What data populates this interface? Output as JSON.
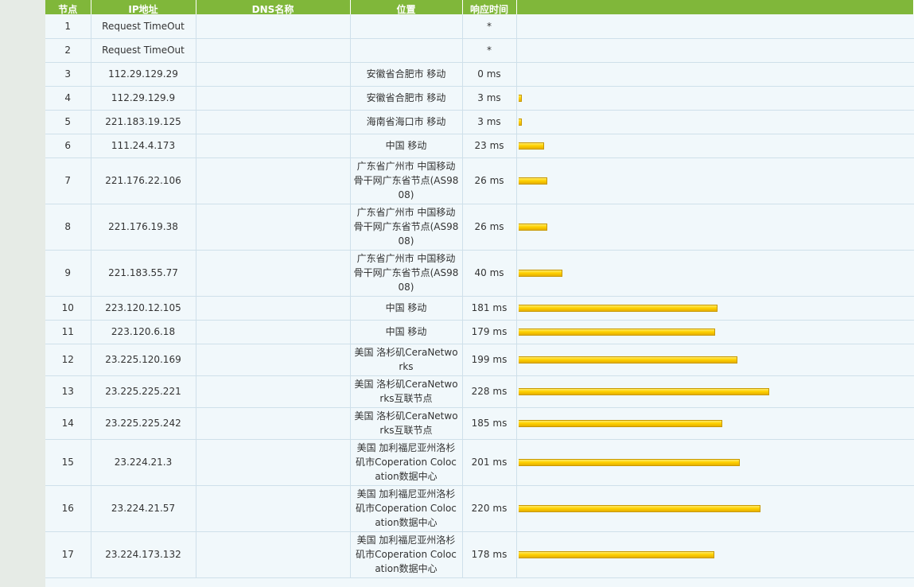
{
  "headers": [
    "节点",
    "IP地址",
    "DNS名称",
    "位置",
    "响应时间",
    ""
  ],
  "rows": [
    {
      "node": "1",
      "ip": "Request TimeOut",
      "dns": "",
      "location": "",
      "time": "*",
      "ms": null
    },
    {
      "node": "2",
      "ip": "Request TimeOut",
      "dns": "",
      "location": "",
      "time": "*",
      "ms": null
    },
    {
      "node": "3",
      "ip": "112.29.129.29",
      "dns": "",
      "location": "安徽省合肥市 移动",
      "time": "0 ms",
      "ms": 0
    },
    {
      "node": "4",
      "ip": "112.29.129.9",
      "dns": "",
      "location": "安徽省合肥市 移动",
      "time": "3 ms",
      "ms": 3
    },
    {
      "node": "5",
      "ip": "221.183.19.125",
      "dns": "",
      "location": "海南省海口市 移动",
      "time": "3 ms",
      "ms": 3
    },
    {
      "node": "6",
      "ip": "111.24.4.173",
      "dns": "",
      "location": "中国 移动",
      "time": "23 ms",
      "ms": 23
    },
    {
      "node": "7",
      "ip": "221.176.22.106",
      "dns": "",
      "location": "广东省广州市 中国移动骨干网广东省节点(AS9808)",
      "time": "26 ms",
      "ms": 26
    },
    {
      "node": "8",
      "ip": "221.176.19.38",
      "dns": "",
      "location": "广东省广州市 中国移动骨干网广东省节点(AS9808)",
      "time": "26 ms",
      "ms": 26
    },
    {
      "node": "9",
      "ip": "221.183.55.77",
      "dns": "",
      "location": "广东省广州市 中国移动骨干网广东省节点(AS9808)",
      "time": "40 ms",
      "ms": 40
    },
    {
      "node": "10",
      "ip": "223.120.12.105",
      "dns": "",
      "location": "中国 移动",
      "time": "181 ms",
      "ms": 181
    },
    {
      "node": "11",
      "ip": "223.120.6.18",
      "dns": "",
      "location": "中国 移动",
      "time": "179 ms",
      "ms": 179
    },
    {
      "node": "12",
      "ip": "23.225.120.169",
      "dns": "",
      "location": "美国 洛杉矶CeraNetworks",
      "time": "199 ms",
      "ms": 199
    },
    {
      "node": "13",
      "ip": "23.225.225.221",
      "dns": "",
      "location": "美国 洛杉矶CeraNetworks互联节点",
      "time": "228 ms",
      "ms": 228
    },
    {
      "node": "14",
      "ip": "23.225.225.242",
      "dns": "",
      "location": "美国 洛杉矶CeraNetworks互联节点",
      "time": "185 ms",
      "ms": 185
    },
    {
      "node": "15",
      "ip": "23.224.21.3",
      "dns": "",
      "location": "美国 加利福尼亚州洛杉矶市Coperation Colocation数据中心",
      "time": "201 ms",
      "ms": 201
    },
    {
      "node": "16",
      "ip": "23.224.21.57",
      "dns": "",
      "location": "美国 加利福尼亚州洛杉矶市Coperation Colocation数据中心",
      "time": "220 ms",
      "ms": 220
    },
    {
      "node": "17",
      "ip": "23.224.173.132",
      "dns": "",
      "location": "美国 加利福尼亚州洛杉矶市Coperation Colocation数据中心",
      "time": "178 ms",
      "ms": 178
    }
  ],
  "colors": {
    "header_bg": "#80b73a",
    "bar": "#ffd200",
    "panel_bg": "#f1f8fb"
  }
}
